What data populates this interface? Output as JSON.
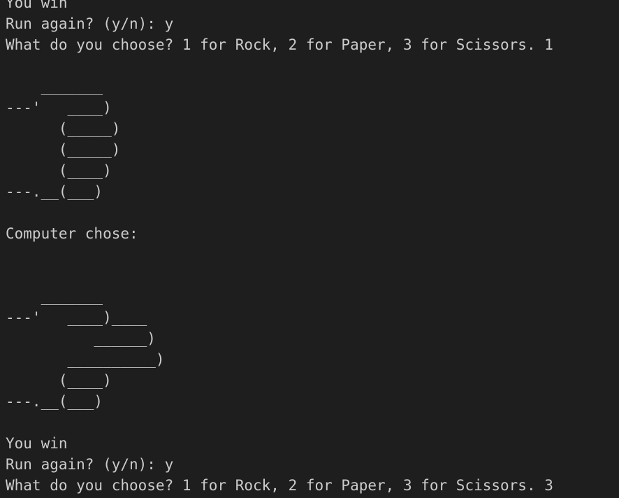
{
  "terminal": {
    "lines": [
      "You win",
      "Run again? (y/n): y",
      "What do you choose? 1 for Rock, 2 for Paper, 3 for Scissors. 1",
      "",
      "    _______",
      "---'   ____)",
      "      (_____)",
      "      (_____)",
      "      (____)",
      "---.__(___)",
      "",
      "Computer chose:",
      "",
      "",
      "    _______",
      "---'   ____)____",
      "          ______)",
      "       __________)",
      "      (____)",
      "---.__(___)",
      "",
      "You win",
      "Run again? (y/n): y",
      "What do you choose? 1 for Rock, 2 for Paper, 3 for Scissors. 3"
    ]
  }
}
